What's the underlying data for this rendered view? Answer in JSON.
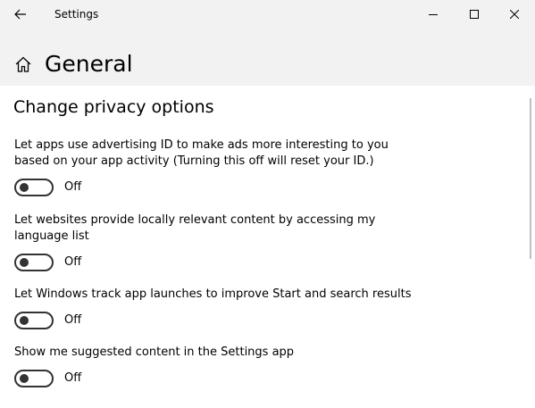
{
  "window": {
    "title": "Settings"
  },
  "header": {
    "page_title": "General"
  },
  "section": {
    "title": "Change privacy options"
  },
  "settings": [
    {
      "description": "Let apps use advertising ID to make ads more interesting to you based on your app activity (Turning this off will reset your ID.)",
      "state": "Off"
    },
    {
      "description": "Let websites provide locally relevant content by accessing my language list",
      "state": "Off"
    },
    {
      "description": "Let Windows track app launches to improve Start and search results",
      "state": "Off"
    },
    {
      "description": "Show me suggested content in the Settings app",
      "state": "Off"
    }
  ],
  "icons": {
    "back": "back-arrow-icon",
    "home": "home-icon",
    "minimize": "minimize-icon",
    "maximize": "maximize-icon",
    "close": "close-icon"
  },
  "colors": {
    "chrome_background": "#f2f2f2",
    "content_background": "#ffffff",
    "toggle_off": "#333333"
  }
}
